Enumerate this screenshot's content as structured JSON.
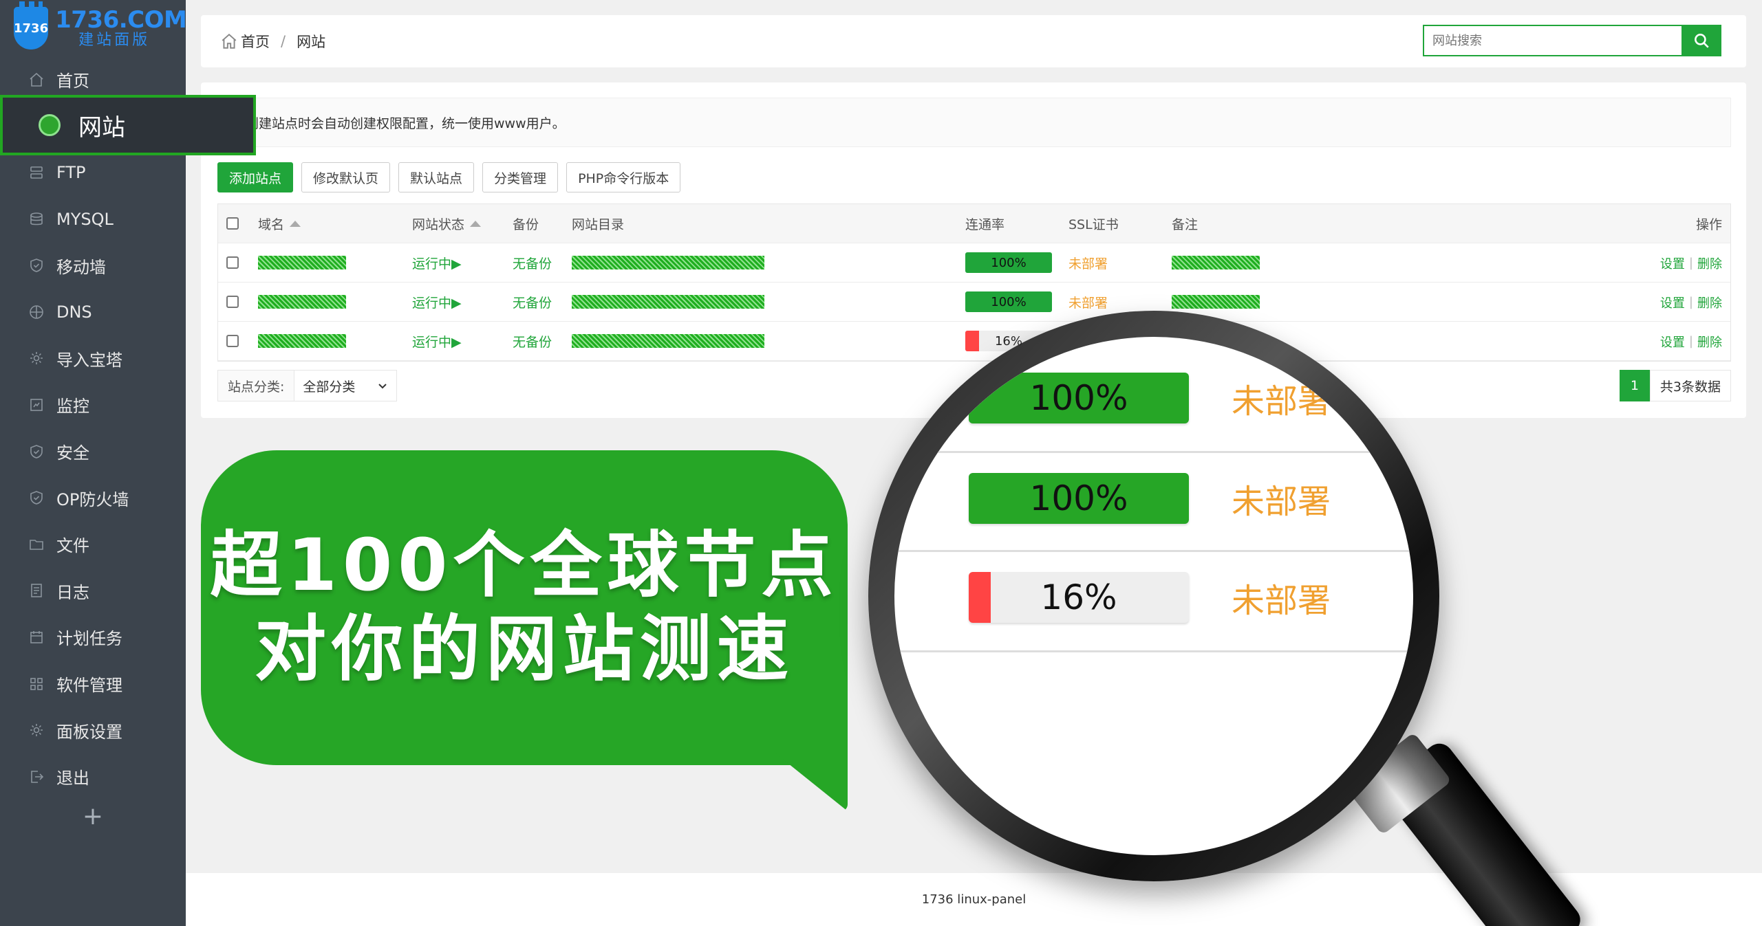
{
  "logo": {
    "badge": "1736",
    "name": "1736.COM",
    "subtitle": "建站面版"
  },
  "sidebar": {
    "items": [
      {
        "label": "首页",
        "icon": "home-icon"
      },
      {
        "label": "网站",
        "icon": "globe-icon"
      },
      {
        "label": "FTP",
        "icon": "ftp-icon"
      },
      {
        "label": "MYSQL",
        "icon": "database-icon"
      },
      {
        "label": "移动墙",
        "icon": "shield-icon"
      },
      {
        "label": "DNS",
        "icon": "dns-icon"
      },
      {
        "label": "导入宝塔",
        "icon": "gear-icon"
      },
      {
        "label": "监控",
        "icon": "monitor-icon"
      },
      {
        "label": "安全",
        "icon": "shield-icon"
      },
      {
        "label": "OP防火墙",
        "icon": "shield-icon"
      },
      {
        "label": "文件",
        "icon": "folder-icon"
      },
      {
        "label": "日志",
        "icon": "log-icon"
      },
      {
        "label": "计划任务",
        "icon": "calendar-icon"
      },
      {
        "label": "软件管理",
        "icon": "apps-icon"
      },
      {
        "label": "面板设置",
        "icon": "gear-icon"
      },
      {
        "label": "退出",
        "icon": "logout-icon"
      }
    ],
    "active": "网站",
    "add": "+"
  },
  "breadcrumb": {
    "home": "首页",
    "sep": "/",
    "current": "网站"
  },
  "search": {
    "placeholder": "网站搜索"
  },
  "notice": "创建站点时会自动创建权限配置，统一使用www用户。",
  "toolbar": [
    "添加站点",
    "修改默认页",
    "默认站点",
    "分类管理",
    "PHP命令行版本"
  ],
  "table": {
    "headers": {
      "domain": "域名",
      "status": "网站状态",
      "backup": "备份",
      "dir": "网站目录",
      "rate": "连通率",
      "ssl": "SSL证书",
      "note": "备注",
      "ops": "操作"
    },
    "rows": [
      {
        "status": "运行中▶",
        "backup": "无备份",
        "rate": 100,
        "rate_label": "100%",
        "ssl": "未部署",
        "op_set": "设置",
        "op_del": "删除"
      },
      {
        "status": "运行中▶",
        "backup": "无备份",
        "rate": 100,
        "rate_label": "100%",
        "ssl": "未部署",
        "op_set": "设置",
        "op_del": "删除"
      },
      {
        "status": "运行中▶",
        "backup": "无备份",
        "rate": 16,
        "rate_label": "16%",
        "ssl": "",
        "op_set": "设置",
        "op_del": "删除"
      }
    ]
  },
  "filter": {
    "label": "站点分类:",
    "value": "全部分类"
  },
  "pager": {
    "page": "1",
    "total": "共3条数据"
  },
  "footer": "1736 linux-panel",
  "promo": {
    "line1": "超100个全球节点",
    "line2": "对你的网站测速"
  },
  "magnifier": {
    "rows": [
      {
        "rate": 100,
        "label": "100%",
        "ssl": "未部署"
      },
      {
        "rate": 100,
        "label": "100%",
        "ssl": "未部署"
      },
      {
        "rate": 16,
        "label": "16%",
        "ssl": "未部署"
      }
    ]
  },
  "colors": {
    "accent": "#20a53a",
    "promo": "#26a626",
    "warn": "#f0a030",
    "danger": "#ff4444",
    "sidebar": "#3c444d"
  }
}
